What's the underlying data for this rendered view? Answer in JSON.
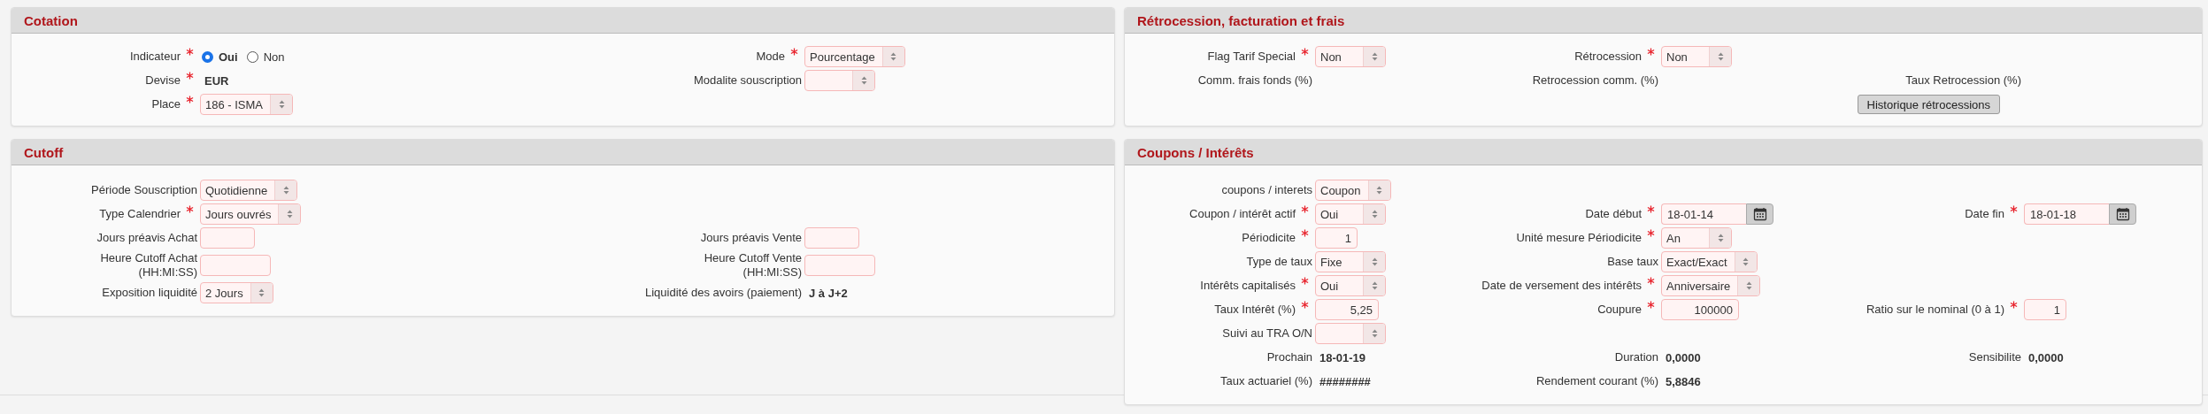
{
  "columns": [
    {
      "panels": [
        {
          "title": "Cotation",
          "rows": [
            [
              {
                "label": "Indicateur",
                "required": true,
                "kind": "radio",
                "options": [
                  {
                    "label": "Oui",
                    "selected": true
                  },
                  {
                    "label": "Non",
                    "selected": false
                  }
                ]
              },
              {
                "label": "Mode",
                "required": true,
                "kind": "select",
                "value": "Pourcentage"
              }
            ],
            [
              {
                "label": "Devise",
                "required": true,
                "kind": "static",
                "value": "EUR"
              },
              {
                "label": "Modalite souscription",
                "required": false,
                "kind": "select"
              }
            ],
            [
              {
                "label": "Place",
                "required": true,
                "kind": "select",
                "value": "186 - ISMA"
              }
            ]
          ]
        },
        {
          "title": "Cutoff",
          "rows": [
            [
              {
                "label": "Période Souscription",
                "required": false,
                "kind": "select",
                "value": "Quotidienne"
              }
            ],
            [
              {
                "label": "Type Calendrier",
                "required": true,
                "kind": "select",
                "value": "Jours ouvrés"
              }
            ],
            [
              {
                "label": "Jours préavis Achat",
                "required": false,
                "kind": "text"
              },
              {
                "label": "Jours préavis Vente",
                "required": false,
                "kind": "text"
              }
            ],
            [
              {
                "label": "Heure Cutoff Achat",
                "label_line2": "(HH:MI:SS)",
                "required": false,
                "kind": "text"
              },
              {
                "label": "Heure Cutoff Vente",
                "label_line2": "(HH:MI:SS)",
                "required": false,
                "kind": "text"
              }
            ],
            [
              {
                "label": "Exposition liquidité",
                "required": false,
                "kind": "select",
                "value": "2 Jours"
              },
              {
                "label": "Liquidité des avoirs (paiement)",
                "required": false,
                "kind": "static",
                "value": "J à J+2"
              }
            ]
          ]
        }
      ]
    },
    {
      "panels": [
        {
          "title": "Rétrocession, facturation et frais",
          "rows": [
            [
              {
                "label": "Flag Tarif Special",
                "required": true,
                "kind": "select",
                "value": "Non"
              },
              {
                "label": "Rétrocession",
                "required": true,
                "kind": "select",
                "value": "Non"
              }
            ],
            [
              {
                "label": "Comm. frais fonds (%)",
                "required": false,
                "kind": "label"
              },
              {
                "label": "Retrocession comm. (%)",
                "required": false,
                "kind": "label"
              },
              {
                "label": "Taux Retrocession (%)",
                "required": false,
                "kind": "label"
              }
            ],
            [
              null,
              null,
              {
                "kind": "button",
                "label": "Historique rétrocessions"
              }
            ]
          ]
        },
        {
          "title": "Coupons / Intérêts",
          "rows": [
            [
              {
                "label": "coupons / interets",
                "required": false,
                "kind": "select",
                "value": "Coupon"
              }
            ],
            [
              {
                "label": "Coupon / intérêt actif",
                "required": true,
                "kind": "select",
                "value": "Oui"
              },
              {
                "label": "Date début",
                "required": true,
                "kind": "date",
                "value": "18-01-14"
              },
              {
                "label": "Date fin",
                "required": true,
                "kind": "date",
                "value": "18-01-18"
              }
            ],
            [
              {
                "label": "Périodicite",
                "required": true,
                "kind": "number",
                "value": "1"
              },
              {
                "label": "Unité mesure Périodicite",
                "required": true,
                "kind": "select",
                "value": "An"
              }
            ],
            [
              {
                "label": "Type de taux",
                "required": false,
                "kind": "select",
                "value": "Fixe"
              },
              {
                "label": "Base taux",
                "required": false,
                "kind": "select",
                "value": "Exact/Exact"
              }
            ],
            [
              {
                "label": "Intérêts capitalisés",
                "required": true,
                "kind": "select",
                "value": "Oui"
              },
              {
                "label": "Date de versement des intérêts",
                "required": true,
                "kind": "select",
                "value": "Anniversaire"
              }
            ],
            [
              {
                "label": "Taux Intérêt (%)",
                "required": true,
                "kind": "number",
                "value": "5,25"
              },
              {
                "label": "Coupure",
                "required": true,
                "kind": "number",
                "value": "100000"
              },
              {
                "label": "Ratio sur le nominal (0 à 1)",
                "required": true,
                "kind": "number",
                "value": "1"
              }
            ],
            [
              {
                "label": "Suivi au TRA O/N",
                "required": false,
                "kind": "select"
              }
            ],
            [
              {
                "label": "Prochain",
                "required": false,
                "kind": "static",
                "value": "18-01-19"
              },
              {
                "label": "Duration",
                "required": false,
                "kind": "static",
                "value": "0,0000"
              },
              {
                "label": "Sensibilite",
                "required": false,
                "kind": "static",
                "value": "0,0000"
              }
            ],
            [
              {
                "label": "Taux actuariel (%)",
                "required": false,
                "kind": "static",
                "value": "########"
              },
              {
                "label": "Rendement courant (%)",
                "required": false,
                "kind": "static",
                "value": "5,8846"
              }
            ]
          ]
        }
      ]
    }
  ]
}
